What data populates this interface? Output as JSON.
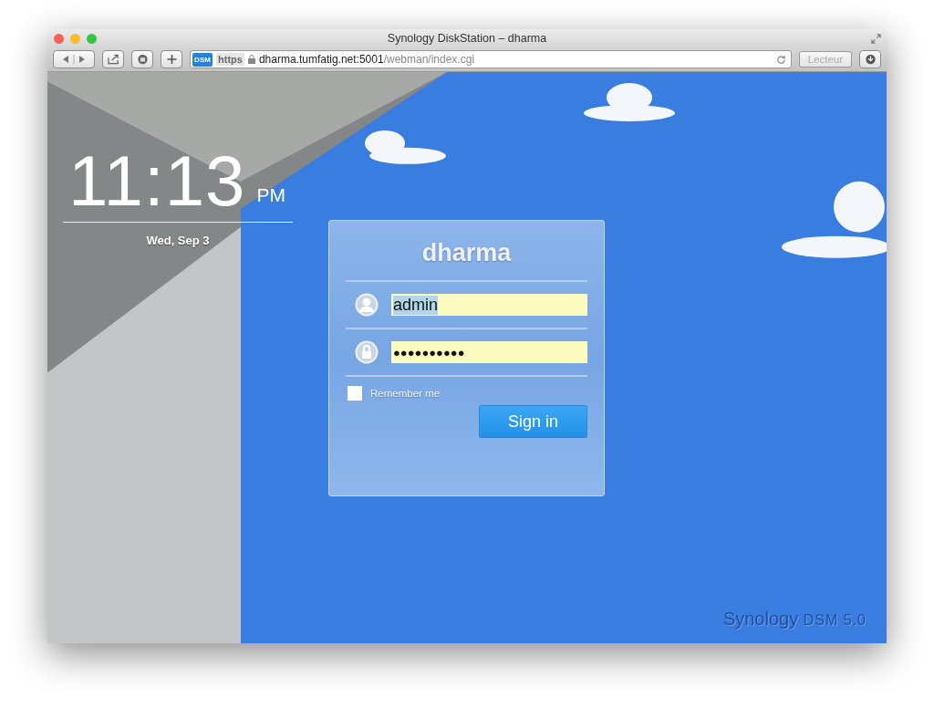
{
  "window": {
    "title": "Synology DiskStation – dharma"
  },
  "toolbar": {
    "favicon": "DSM",
    "url_scheme": "https",
    "url_host": "dharma.tumfatig.net:5001",
    "url_path": "/webman/index.cgi",
    "reader_button": "Lecteur"
  },
  "clock": {
    "time": "11:13",
    "ampm": "PM",
    "date": "Wed, Sep 3"
  },
  "login": {
    "title": "dharma",
    "username": {
      "value": "admin",
      "selected": true
    },
    "password": {
      "value": "●●●●●●●●●●"
    },
    "remember": {
      "label": "Remember me",
      "checked": false
    },
    "sign_in": "Sign in"
  },
  "branding": {
    "logo": "Synology",
    "product": "DSM 5.0"
  }
}
